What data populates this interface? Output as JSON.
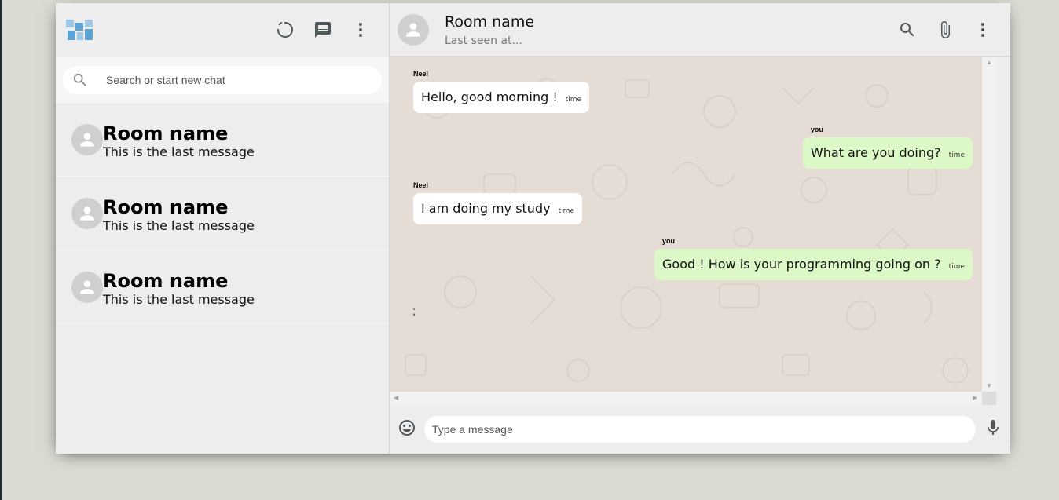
{
  "sidebar": {
    "search_placeholder": "Search or start new chat",
    "chats": [
      {
        "name": "Room name",
        "last_message": "This is the last message"
      },
      {
        "name": "Room name",
        "last_message": "This is the last message"
      },
      {
        "name": "Room name",
        "last_message": "This is the last message"
      }
    ]
  },
  "chat": {
    "room_name": "Room name",
    "last_seen": "Last seen at...",
    "messages": [
      {
        "sender": "Neel",
        "text": "Hello, good morning !",
        "time": "time",
        "mine": false
      },
      {
        "sender": "you",
        "text": "What are you doing?",
        "time": "time",
        "mine": true
      },
      {
        "sender": "Neel",
        "text": "I am doing my study",
        "time": "time",
        "mine": false
      },
      {
        "sender": "you",
        "text": "Good ! How is your programming going on ?",
        "time": "time",
        "mine": true
      }
    ],
    "stray_text": ";",
    "input_placeholder": "Type a message"
  },
  "colors": {
    "app_background": "#dadbd3",
    "panel": "#ededed",
    "chat_background": "#e5ddd5",
    "my_bubble": "#dcf8c6",
    "their_bubble": "#ffffff"
  },
  "icons": [
    "logo",
    "status-icon",
    "new-chat-icon",
    "more-vert-icon",
    "search-icon",
    "avatar-icon",
    "attach-icon",
    "emoji-icon",
    "mic-icon"
  ]
}
